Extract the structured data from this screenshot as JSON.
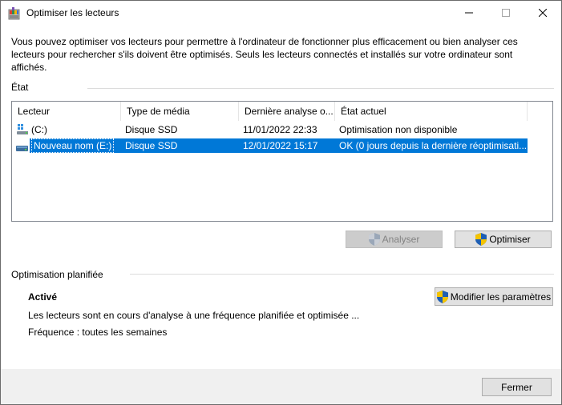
{
  "window": {
    "title": "Optimiser les lecteurs",
    "icon": "defrag-app-icon",
    "controls": {
      "minimize": "—",
      "maximize": "☐",
      "close": "✕"
    }
  },
  "description": "Vous pouvez optimiser vos lecteurs pour permettre à l'ordinateur de fonctionner plus efficacement ou bien analyser ces lecteurs pour rechercher s'ils doivent être optimisés. Seuls les lecteurs connectés et installés sur votre ordinateur sont affichés.",
  "status_group": {
    "label": "État",
    "columns": [
      "Lecteur",
      "Type de média",
      "Dernière analyse o...",
      "État actuel"
    ],
    "rows": [
      {
        "icon": "windows-drive-icon",
        "drive": "(C:)",
        "media": "Disque SSD",
        "last": "11/01/2022 22:33",
        "state": "Optimisation non disponible",
        "selected": false
      },
      {
        "icon": "drive-icon",
        "drive": "Nouveau nom (E:)",
        "media": "Disque SSD",
        "last": "12/01/2022 15:17",
        "state": "OK (0 jours depuis la dernière réoptimisati...",
        "selected": true
      }
    ]
  },
  "buttons": {
    "analyze": "Analyser",
    "optimize": "Optimiser",
    "modify": "Modifier les paramètres",
    "close": "Fermer"
  },
  "scheduled": {
    "label": "Optimisation planifiée",
    "status": "Activé",
    "detail": "Les lecteurs sont en cours d'analyse à une fréquence planifiée et optimisée ...",
    "frequency": "Fréquence : toutes les semaines"
  },
  "colors": {
    "selection": "#0078d7",
    "footer": "#f0f0f0",
    "shield_blue": "#1f5fb4",
    "shield_yellow": "#f5c400"
  }
}
